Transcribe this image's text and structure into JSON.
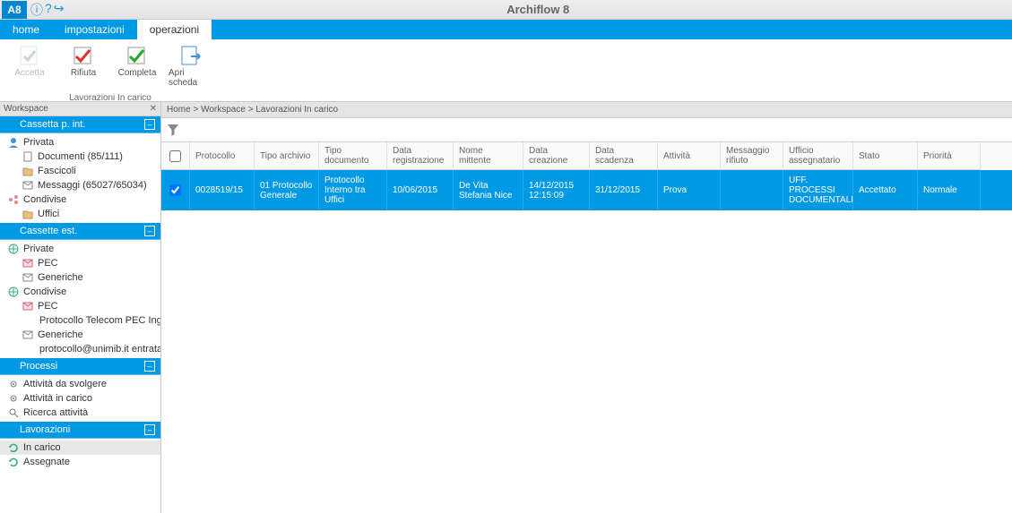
{
  "app": {
    "title": "Archiflow 8",
    "logo_text": "A8"
  },
  "menubar": {
    "tabs": [
      {
        "label": "home"
      },
      {
        "label": "impostazioni"
      },
      {
        "label": "operazioni",
        "active": true
      }
    ]
  },
  "ribbon": {
    "buttons": [
      {
        "label": "Accetta",
        "disabled": true
      },
      {
        "label": "Rifiuta"
      },
      {
        "label": "Completa"
      },
      {
        "label": "Apri scheda"
      }
    ],
    "group_caption": "Lavorazioni In carico"
  },
  "sidebar": {
    "title": "Workspace",
    "sections": [
      {
        "title": "Cassetta p. int.",
        "items": [
          {
            "label": "Privata",
            "icon": "person",
            "lvl": 0
          },
          {
            "label": "Documenti (85/111)",
            "icon": "doc",
            "lvl": 1
          },
          {
            "label": "Fascicoli",
            "icon": "folder",
            "lvl": 1
          },
          {
            "label": "Messaggi (65027/65034)",
            "icon": "mail",
            "lvl": 1
          },
          {
            "label": "Condivise",
            "icon": "share",
            "lvl": 0
          },
          {
            "label": "Uffici",
            "icon": "folder",
            "lvl": 1
          }
        ]
      },
      {
        "title": "Cassette est.",
        "items": [
          {
            "label": "Private",
            "icon": "globe",
            "lvl": 0
          },
          {
            "label": "PEC",
            "icon": "pec",
            "lvl": 1
          },
          {
            "label": "Generiche",
            "icon": "mail",
            "lvl": 1
          },
          {
            "label": "Condivise",
            "icon": "globe",
            "lvl": 0
          },
          {
            "label": "PEC",
            "icon": "pec",
            "lvl": 1
          },
          {
            "label": "Protocollo Telecom PEC Ingresso",
            "icon": "",
            "lvl": 2
          },
          {
            "label": "Generiche",
            "icon": "mail",
            "lvl": 1
          },
          {
            "label": "protocollo@unimib.it entrata",
            "icon": "",
            "lvl": 2
          }
        ]
      },
      {
        "title": "Processi",
        "items": [
          {
            "label": "Attività da svolgere",
            "icon": "gear",
            "lvl": 0
          },
          {
            "label": "Attività in carico",
            "icon": "gear",
            "lvl": 0
          },
          {
            "label": "Ricerca attività",
            "icon": "search",
            "lvl": 0
          }
        ]
      },
      {
        "title": "Lavorazioni",
        "items": [
          {
            "label": "In carico",
            "icon": "cycle",
            "lvl": 0,
            "selected": true
          },
          {
            "label": "Assegnate",
            "icon": "cycle",
            "lvl": 0
          }
        ]
      }
    ]
  },
  "breadcrumb": {
    "parts": [
      "Home",
      "Workspace",
      "Lavorazioni In carico"
    ]
  },
  "grid": {
    "columns": [
      "Protocollo",
      "Tipo archivio",
      "Tipo documento",
      "Data registrazione",
      "Nome mittente",
      "Data creazione",
      "Data scadenza",
      "Attività",
      "Messaggio rifiuto",
      "Ufficio assegnatario",
      "Stato",
      "Priorità"
    ],
    "rows": [
      {
        "checked": true,
        "protocollo": "0028519/15",
        "tipo_archivio": "01 Protocollo Generale",
        "tipo_documento": "Protocollo Interno tra Uffici",
        "data_reg": "10/06/2015",
        "mittente": "De Vita Stefania Nice",
        "data_cre": "14/12/2015 12:15:09",
        "data_sca": "31/12/2015",
        "attivita": "Prova",
        "msg_rifiuto": "",
        "ufficio": "UFF. PROCESSI DOCUMENTALI",
        "stato": "Accettato",
        "priorita": "Normale"
      }
    ]
  }
}
